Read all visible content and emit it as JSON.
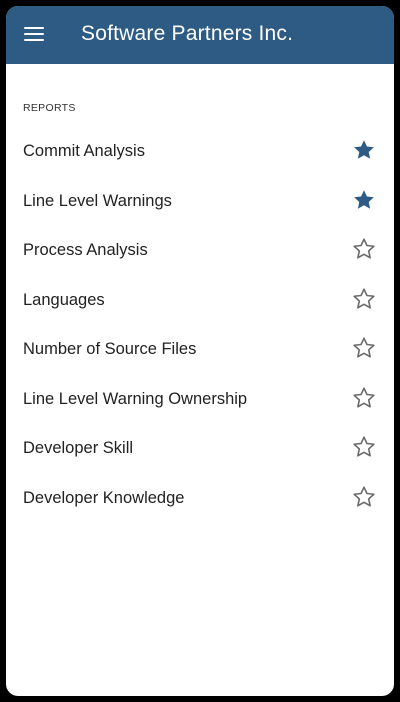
{
  "app_bar": {
    "title": "Software Partners Inc.",
    "menu_icon": "hamburger-menu-icon",
    "background_color": "#2d5b84"
  },
  "section": {
    "header": "REPORTS"
  },
  "reports": [
    {
      "label": "Commit Analysis",
      "starred": true
    },
    {
      "label": "Line Level Warnings",
      "starred": true
    },
    {
      "label": "Process Analysis",
      "starred": false
    },
    {
      "label": "Languages",
      "starred": false
    },
    {
      "label": "Number of Source Files",
      "starred": false
    },
    {
      "label": "Line Level Warning Ownership",
      "starred": false
    },
    {
      "label": "Developer Skill",
      "starred": false
    },
    {
      "label": "Developer Knowledge",
      "starred": false
    }
  ],
  "colors": {
    "star_filled": "#2d5b84",
    "star_outline": "#6b6b6b"
  }
}
